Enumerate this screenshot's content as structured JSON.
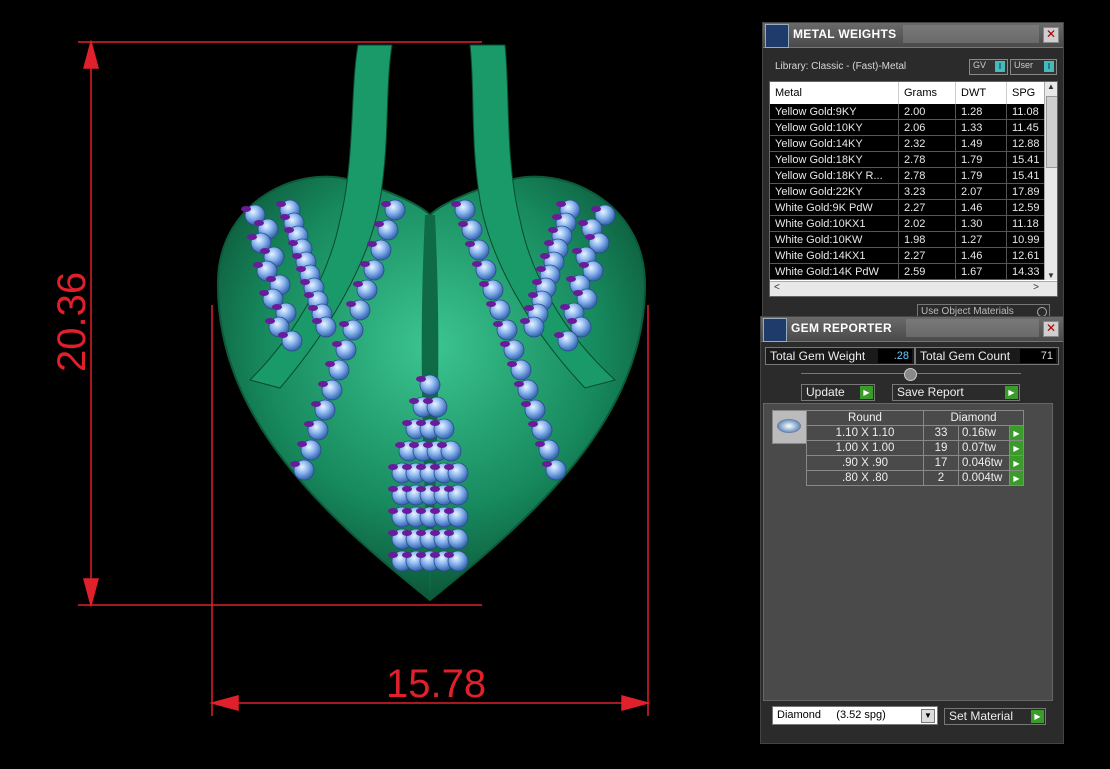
{
  "dimensions": {
    "height": "20.36",
    "width": "15.78"
  },
  "colors": {
    "dimension": "#e0202a",
    "metal": "#1a8a5e",
    "stones": "#8fb8f0",
    "prongs": "#6a1a9a"
  },
  "metal_panel": {
    "title": "METAL WEIGHTS",
    "library": "Library: Classic - (Fast)-Metal",
    "gv_label": "GV",
    "user_label": "User",
    "columns": [
      "Metal",
      "Grams",
      "DWT",
      "SPG"
    ],
    "rows": [
      {
        "metal": "Yellow Gold:9KY",
        "grams": "2.00",
        "dwt": "1.28",
        "spg": "11.08"
      },
      {
        "metal": "Yellow Gold:10KY",
        "grams": "2.06",
        "dwt": "1.33",
        "spg": "11.45"
      },
      {
        "metal": "Yellow Gold:14KY",
        "grams": "2.32",
        "dwt": "1.49",
        "spg": "12.88"
      },
      {
        "metal": "Yellow Gold:18KY",
        "grams": "2.78",
        "dwt": "1.79",
        "spg": "15.41"
      },
      {
        "metal": "Yellow Gold:18KY R...",
        "grams": "2.78",
        "dwt": "1.79",
        "spg": "15.41"
      },
      {
        "metal": "Yellow Gold:22KY",
        "grams": "3.23",
        "dwt": "2.07",
        "spg": "17.89"
      },
      {
        "metal": "White Gold:9K PdW",
        "grams": "2.27",
        "dwt": "1.46",
        "spg": "12.59"
      },
      {
        "metal": "White Gold:10KX1",
        "grams": "2.02",
        "dwt": "1.30",
        "spg": "11.18"
      },
      {
        "metal": "White Gold:10KW",
        "grams": "1.98",
        "dwt": "1.27",
        "spg": "10.99"
      },
      {
        "metal": "White Gold:14KX1",
        "grams": "2.27",
        "dwt": "1.46",
        "spg": "12.61"
      },
      {
        "metal": "White Gold:14K PdW",
        "grams": "2.59",
        "dwt": "1.67",
        "spg": "14.33"
      }
    ],
    "use_object_materials": "Use Object Materials"
  },
  "gem_panel": {
    "title": "GEM REPORTER",
    "total_weight_label": "Total Gem Weight",
    "total_weight_value": ".28",
    "total_count_label": "Total Gem Count",
    "total_count_value": "71",
    "update_label": "Update",
    "save_label": "Save Report",
    "shape_header": "Round",
    "material_header": "Diamond",
    "gems": [
      {
        "size": "1.10 X 1.10",
        "count": "33",
        "weight": "0.16tw"
      },
      {
        "size": "1.00 X 1.00",
        "count": "19",
        "weight": "0.07tw"
      },
      {
        "size": ".90 X .90",
        "count": "17",
        "weight": "0.046tw"
      },
      {
        "size": ".80 X .80",
        "count": "2",
        "weight": "0.004tw"
      }
    ],
    "material_select": "Diamond     (3.52 spg)",
    "set_material_label": "Set Material"
  }
}
